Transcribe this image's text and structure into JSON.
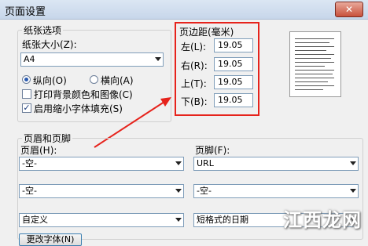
{
  "window": {
    "title": "页面设置",
    "close_glyph": "✕"
  },
  "paper": {
    "group_title": "纸张选项",
    "size_label": "纸张大小(Z):",
    "size_value": "A4",
    "portrait_label": "纵向(O)",
    "landscape_label": "横向(A)",
    "orientation_selected": "portrait",
    "print_bg_label": "打印背景颜色和图像(C)",
    "print_bg_checked": false,
    "shrink_label": "启用缩小字体填充(S)",
    "shrink_checked": true,
    "check_glyph": "✓"
  },
  "margins": {
    "group_title": "页边距(毫米)",
    "left_label": "左(L):",
    "left_value": "19.05",
    "right_label": "右(R):",
    "right_value": "19.05",
    "top_label": "上(T):",
    "top_value": "19.05",
    "bottom_label": "下(B):",
    "bottom_value": "19.05",
    "highlight_color": "#e6231c"
  },
  "header_footer": {
    "group_title": "页眉和页脚",
    "header_label": "页眉(H):",
    "footer_label": "页脚(F):",
    "header_row1": "-空-",
    "footer_row1": "URL",
    "header_row2": "-空-",
    "footer_row2": "-空-",
    "header_row3": "自定义",
    "footer_row3": "短格式的日期",
    "change_font_button": "更改字体(N)"
  },
  "watermark": "江西龙网"
}
